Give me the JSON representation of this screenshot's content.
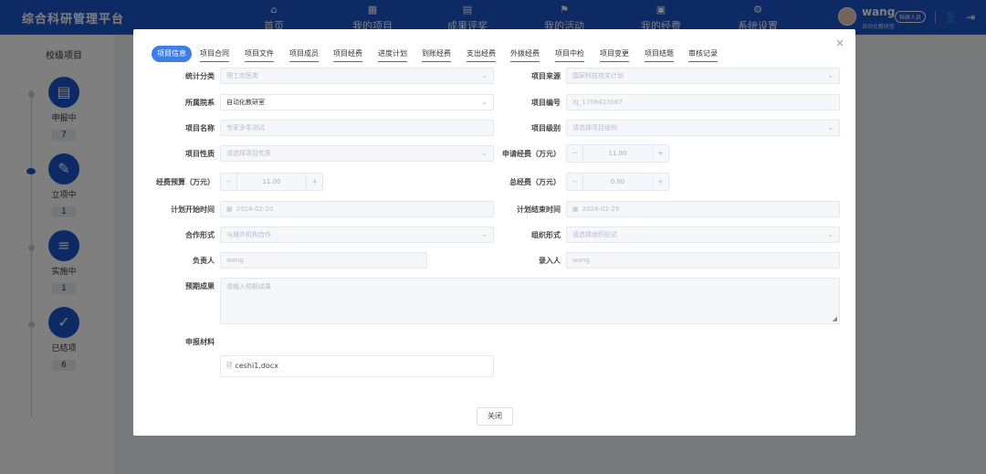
{
  "header": {
    "brand": "综合科研管理平台",
    "nav": [
      {
        "label": "首页",
        "icon": "home-icon"
      },
      {
        "label": "我的项目",
        "icon": "grid-icon"
      },
      {
        "label": "成果评奖",
        "icon": "award-icon"
      },
      {
        "label": "我的活动",
        "icon": "flag-icon"
      },
      {
        "label": "我的经费",
        "icon": "money-icon"
      },
      {
        "label": "系统设置",
        "icon": "gear-icon"
      }
    ],
    "user": {
      "name": "wang",
      "dept": "自动化教研室",
      "role": "科研人员"
    }
  },
  "sidebar": {
    "title": "校级项目",
    "stages": [
      {
        "label": "申报中",
        "count": "7"
      },
      {
        "label": "立项中",
        "count": "1"
      },
      {
        "label": "实施中",
        "count": "1"
      },
      {
        "label": "已结项",
        "count": "6"
      }
    ]
  },
  "dialog": {
    "tabs": [
      "项目信息",
      "项目合同",
      "项目文件",
      "项目成员",
      "项目经费",
      "进度计划",
      "到账经费",
      "支出经费",
      "外拨经费",
      "项目中检",
      "项目变更",
      "项目结题",
      "审核记录"
    ],
    "fields": {
      "stat_category": {
        "label": "统计分类",
        "value": "理工农医类"
      },
      "source": {
        "label": "项目来源",
        "value": "国家科技攻关计划"
      },
      "department": {
        "label": "所属院系",
        "value": "自动化教研室"
      },
      "code": {
        "label": "项目编号",
        "value": "XJ_1708423067"
      },
      "name": {
        "label": "项目名称",
        "value": "专家多条测试"
      },
      "level": {
        "label": "项目级别",
        "placeholder": "请选择项目级别"
      },
      "nature": {
        "label": "项目性质",
        "placeholder": "请选择项目性质"
      },
      "apply_funds": {
        "label": "申请经费（万元）",
        "value": "11.00"
      },
      "budget": {
        "label": "经费预算（万元）",
        "value": "11.00"
      },
      "total_funds": {
        "label": "总经费（万元）",
        "value": "0.00"
      },
      "start": {
        "label": "计划开始时间",
        "value": "2024-02-20"
      },
      "end": {
        "label": "计划结束时间",
        "value": "2024-02-29"
      },
      "coop": {
        "label": "合作形式",
        "value": "与境外机构合作"
      },
      "org": {
        "label": "组织形式",
        "placeholder": "请选择组织形式"
      },
      "leader": {
        "label": "负责人",
        "value": "wang"
      },
      "entry": {
        "label": "录入人",
        "value": "wang"
      },
      "expected": {
        "label": "预期成果",
        "placeholder": "请输入预期成果"
      },
      "materials": {
        "label": "申报材料",
        "file": "ceshi1.docx"
      }
    },
    "close_label": "关闭"
  }
}
